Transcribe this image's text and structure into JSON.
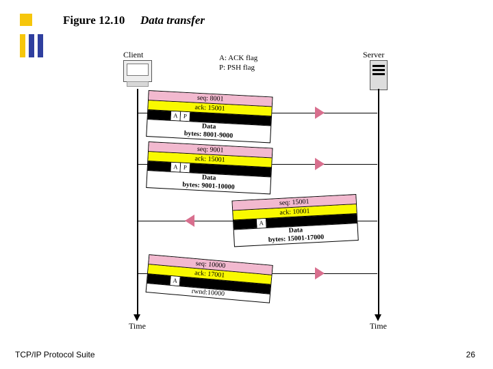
{
  "figure": {
    "label": "Figure 12.10",
    "title": "Data transfer"
  },
  "footer": {
    "suite": "TCP/IP Protocol Suite",
    "page": "26"
  },
  "legend": {
    "ack": "A: ACK flag",
    "psh": "P: PSH flag"
  },
  "nodes": {
    "client": "Client",
    "server": "Server",
    "time": "Time"
  },
  "seg1": {
    "seq": "seq: 8001",
    "ack": "ack: 15001",
    "f1": "A",
    "f2": "P",
    "d1": "Data",
    "d2": "bytes: 8001-9000"
  },
  "seg2": {
    "seq": "seq: 9001",
    "ack": "ack: 15001",
    "f1": "A",
    "f2": "P",
    "d1": "Data",
    "d2": "bytes: 9001-10000"
  },
  "seg3": {
    "seq": "seq: 15001",
    "ack": "ack: 10001",
    "f1": "A",
    "d1": "Data",
    "d2": "bytes: 15001-17000"
  },
  "seg4": {
    "seq": "seq: 10000",
    "ack": "ack: 17001",
    "f1": "A",
    "d2": "rwnd:10000"
  }
}
